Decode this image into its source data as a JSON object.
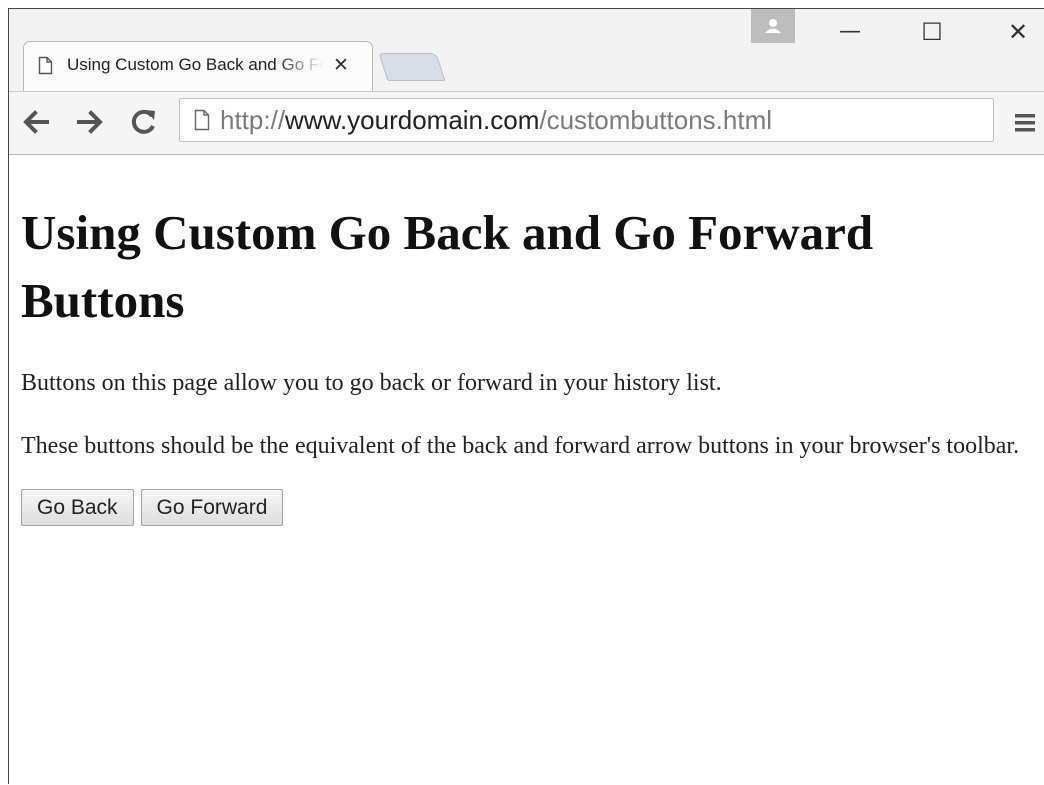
{
  "tab": {
    "title": "Using Custom Go Back and Go Forward Buttons",
    "close_glyph": "✕"
  },
  "window_controls": {
    "minimize": "—",
    "maximize": "☐",
    "close": "✕"
  },
  "address_bar": {
    "scheme": "http://",
    "host": "www.yourdomain.com",
    "path": "/custombuttons.html"
  },
  "page": {
    "heading": "Using Custom Go Back and Go Forward Buttons",
    "paragraph_1": "Buttons on this page allow you to go back or forward in your history list.",
    "paragraph_2": "These buttons should be the equivalent of the back and forward arrow buttons in your browser's toolbar.",
    "go_back_label": "Go Back",
    "go_forward_label": "Go Forward"
  },
  "icons": {
    "tab_page": "page-icon",
    "omnibox_page": "page-icon",
    "back": "arrow-left-icon",
    "forward": "arrow-right-icon",
    "reload": "reload-icon",
    "menu": "hamburger-menu-icon",
    "profile": "user-icon"
  },
  "colors": {
    "url_muted": "#7b7b7b",
    "url_host": "#222222",
    "new_tab_fill": "#d7dde6"
  }
}
